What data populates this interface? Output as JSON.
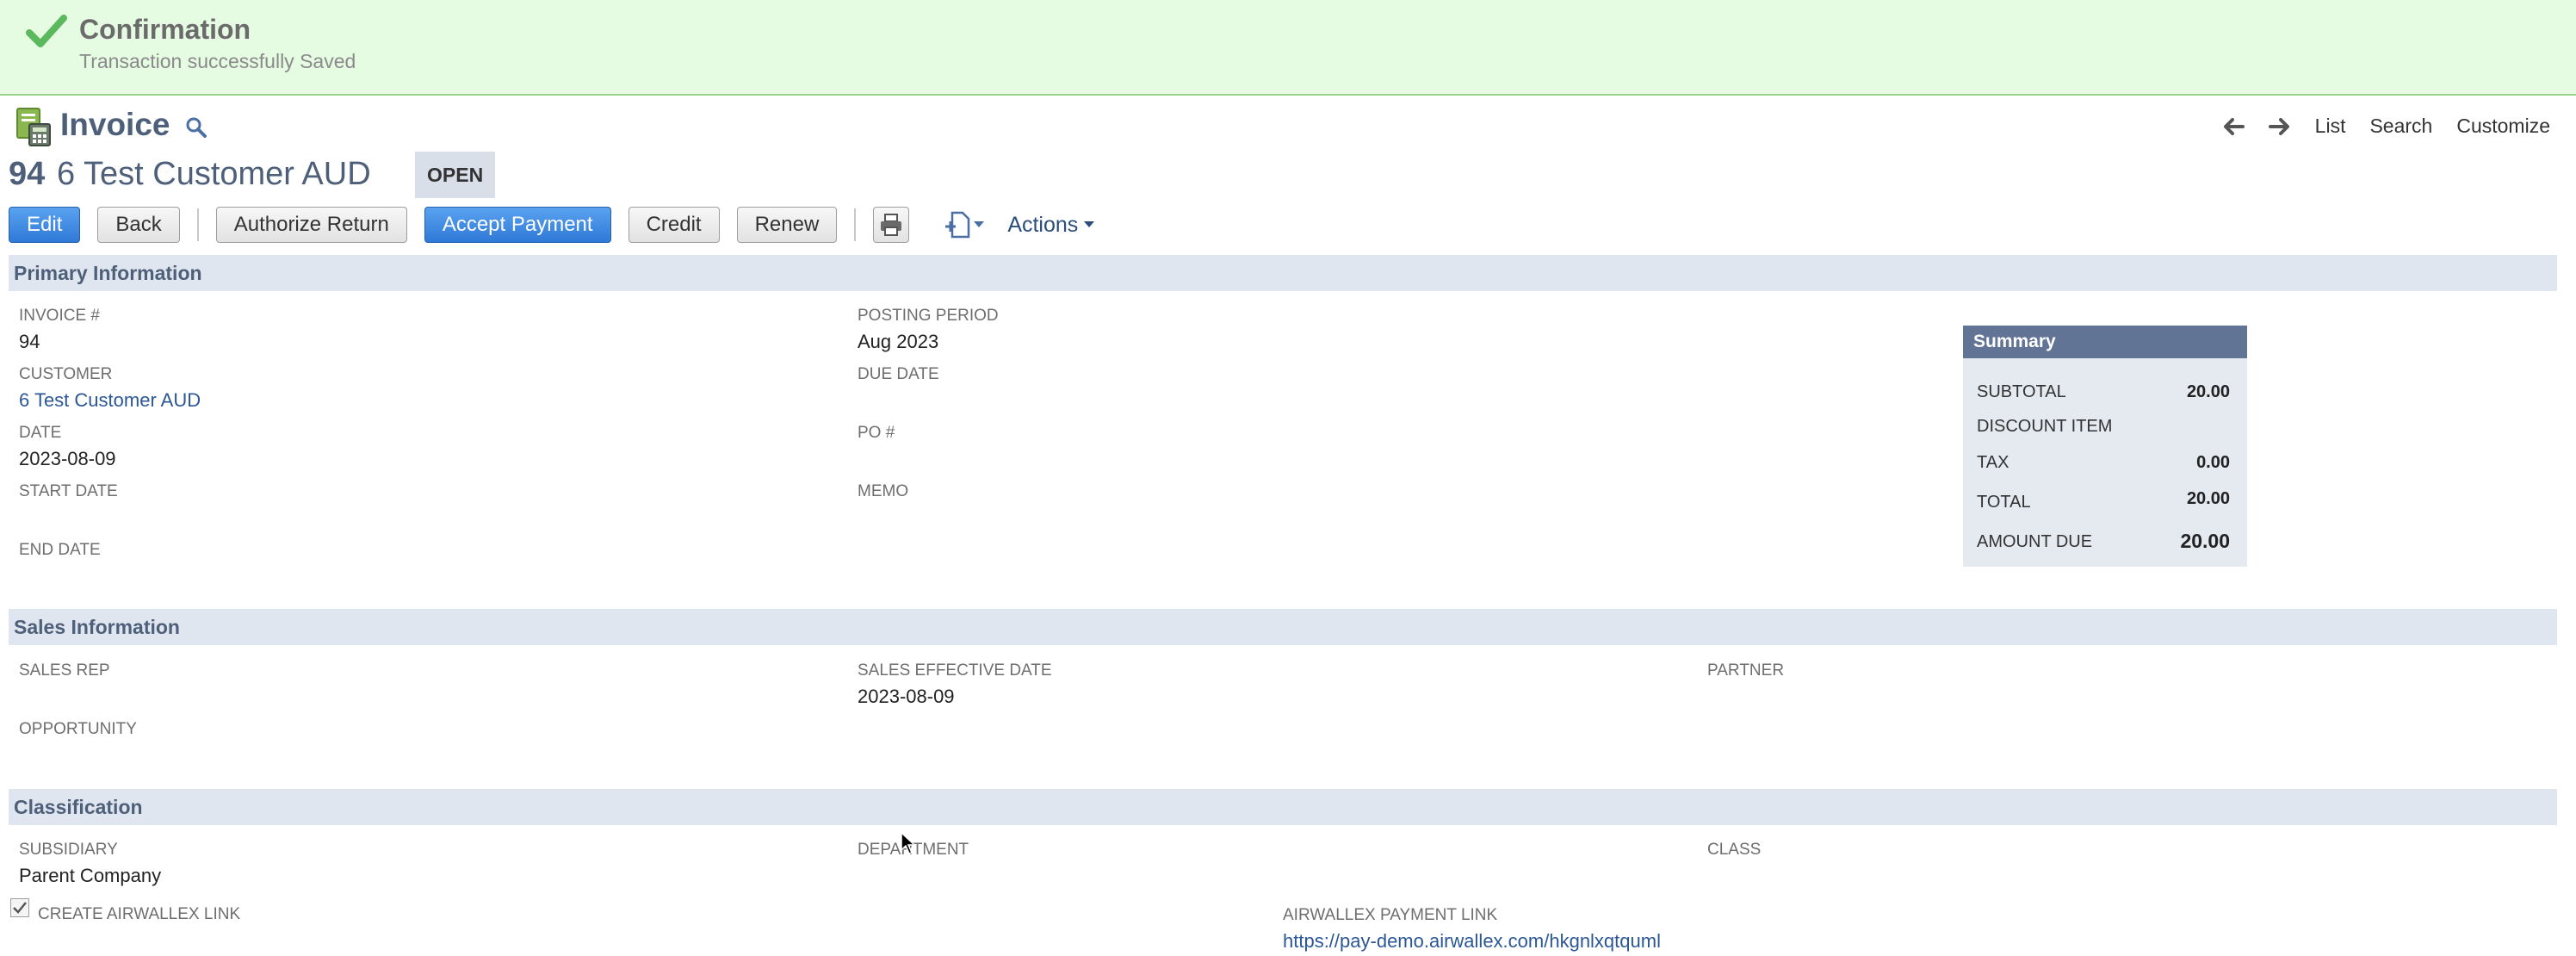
{
  "banner": {
    "title": "Confirmation",
    "message": "Transaction successfully Saved"
  },
  "header": {
    "title": "Invoice",
    "nav": {
      "list": "List",
      "search": "Search",
      "customize": "Customize"
    }
  },
  "record": {
    "number": "94",
    "name": "6 Test Customer AUD",
    "status": "OPEN"
  },
  "toolbar": {
    "edit": "Edit",
    "back": "Back",
    "authorize_return": "Authorize Return",
    "accept_payment": "Accept Payment",
    "credit": "Credit",
    "renew": "Renew",
    "actions": "Actions"
  },
  "primary": {
    "heading": "Primary Information",
    "invoice_label": "INVOICE #",
    "invoice_value": "94",
    "customer_label": "CUSTOMER",
    "customer_value": "6 Test Customer AUD",
    "date_label": "DATE",
    "date_value": "2023-08-09",
    "start_date_label": "START DATE",
    "end_date_label": "END DATE",
    "posting_period_label": "POSTING PERIOD",
    "posting_period_value": "Aug 2023",
    "due_date_label": "DUE DATE",
    "po_label": "PO #",
    "memo_label": "MEMO"
  },
  "summary": {
    "heading": "Summary",
    "subtotal_label": "SUBTOTAL",
    "subtotal_value": "20.00",
    "discount_label": "DISCOUNT ITEM",
    "tax_label": "TAX",
    "tax_value": "0.00",
    "total_label": "TOTAL",
    "total_value": "20.00",
    "amount_due_label": "AMOUNT DUE",
    "amount_due_value": "20.00"
  },
  "sales": {
    "heading": "Sales Information",
    "sales_rep_label": "SALES REP",
    "sales_effective_date_label": "SALES EFFECTIVE DATE",
    "sales_effective_date_value": "2023-08-09",
    "partner_label": "PARTNER",
    "opportunity_label": "OPPORTUNITY"
  },
  "classification": {
    "heading": "Classification",
    "subsidiary_label": "SUBSIDIARY",
    "subsidiary_value": "Parent Company",
    "department_label": "DEPARTMENT",
    "class_label": "CLASS",
    "create_link_label": "CREATE AIRWALLEX LINK",
    "payment_link_label": "AIRWALLEX PAYMENT LINK",
    "payment_link_value": "https://pay-demo.airwallex.com/hkgnlxqtquml"
  }
}
